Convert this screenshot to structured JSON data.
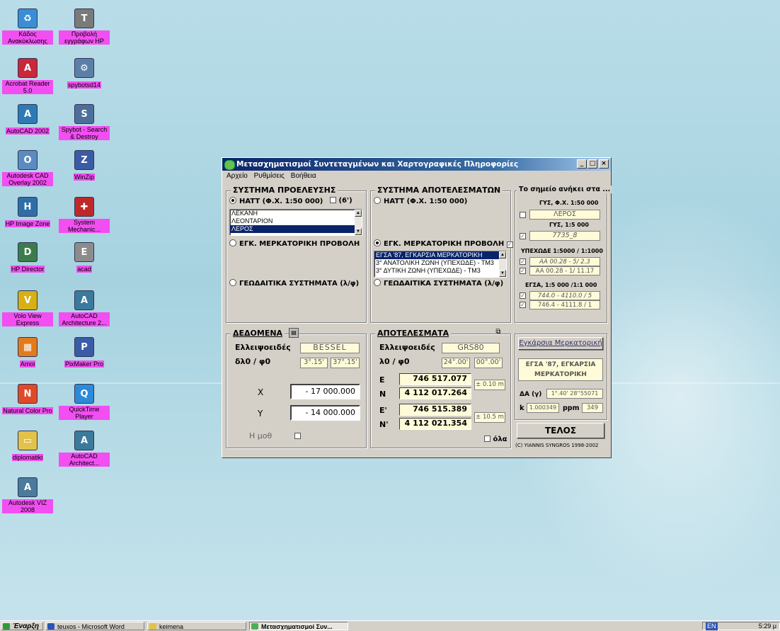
{
  "desktop": {
    "icons": [
      {
        "label": "Κάδος Ανακύκλωσης",
        "glyph": "♻",
        "color": "#3a8fd4"
      },
      {
        "label": "Προβολή εγγράφων HP",
        "glyph": "T",
        "color": "#7a7a7a"
      },
      {
        "label": "Acrobat Reader 5.0",
        "glyph": "A",
        "color": "#c8283a"
      },
      {
        "label": "spybotsd14",
        "glyph": "⚙",
        "color": "#5c7fa8"
      },
      {
        "label": "AutoCAD 2002",
        "glyph": "A",
        "color": "#2c7bb5"
      },
      {
        "label": "Spybot - Search & Destroy",
        "glyph": "S",
        "color": "#4c6f9a"
      },
      {
        "label": "Autodesk CAD Overlay 2002",
        "glyph": "O",
        "color": "#5a8cc0"
      },
      {
        "label": "WinZip",
        "glyph": "Z",
        "color": "#3c5ba6"
      },
      {
        "label": "HP Image Zone",
        "glyph": "H",
        "color": "#2f6fa8"
      },
      {
        "label": "System Mechanic...",
        "glyph": "✚",
        "color": "#c02828"
      },
      {
        "label": "HP Director",
        "glyph": "D",
        "color": "#3c7c4c"
      },
      {
        "label": "acad",
        "glyph": "E",
        "color": "#8c8c8c"
      },
      {
        "label": "Volo View Express",
        "glyph": "V",
        "color": "#d6b014"
      },
      {
        "label": "AutoCAD Architecture 2...",
        "glyph": "A",
        "color": "#3a7a9c"
      },
      {
        "label": "Amoi",
        "glyph": "▦",
        "color": "#e27a1e"
      },
      {
        "label": "PixMaker Pro",
        "glyph": "P",
        "color": "#3a5ca8"
      },
      {
        "label": "Natural Color Pro",
        "glyph": "N",
        "color": "#e04a28"
      },
      {
        "label": "QuickTime Player",
        "glyph": "Q",
        "color": "#2c8ad8"
      },
      {
        "label": "diplomatiki",
        "glyph": "▭",
        "color": "#e2c24a"
      },
      {
        "label": "AutoCAD Architect...",
        "glyph": "A",
        "color": "#3a7a9c"
      },
      {
        "label": "Autodesk VIZ 2008",
        "glyph": "A",
        "color": "#4a7a9c"
      }
    ]
  },
  "taskbar": {
    "start_label": "Έναρξη",
    "buttons": [
      {
        "label": "teuxos - Microsoft Word",
        "color": "#2a56b4"
      },
      {
        "label": "keimena",
        "color": "#e2c24a"
      },
      {
        "label": "Μετασχηματισμοί Συν...",
        "color": "#4caf50"
      }
    ],
    "tray_lang": "EN",
    "tray_time": "5:29 μ"
  },
  "window": {
    "title": "Μετασχηματισμοί Συντεταγμένων και Χαρτογραφικές Πληροφορίες",
    "buttons": {
      "minimize": "_",
      "maximize": "□",
      "close": "×"
    },
    "menu": [
      "Αρχείο",
      "Ρυθμίσεις",
      "Βοήθεια"
    ],
    "source": {
      "title": "ΣΥΣΤΗΜΑ ΠΡΟΕΛΕΥΣΗΣ",
      "opt_hatt": "HATT (Φ.Χ. 1:50 000)",
      "opt_6": "(6')",
      "hatt_list": [
        "ΛΕΚΑΝΗ",
        "ΛΕΟΝΤΑΡΙΟΝ",
        "ΛΕΡΟΣ"
      ],
      "hatt_selected": 2,
      "opt_merc": "ΕΓΚ. ΜΕΡΚΑΤΟΡΙΚΗ ΠΡΟΒΟΛΗ",
      "opt_geod": "ΓΕΩΔΑΙΤΙΚΑ ΣΥΣΤΗΜΑΤΑ (λ/φ)"
    },
    "target": {
      "title": "ΣΥΣΤΗΜΑ ΑΠΟΤΕΛΕΣΜΑΤΩΝ",
      "opt_hatt": "HATT (Φ.Χ. 1:50 000)",
      "opt_merc": "ΕΓΚ. ΜΕΡΚΑΤΟΡΙΚΗ ΠΡΟΒΟΛΗ",
      "merc_list": [
        "ΕΓΣΑ '87, ΕΓΚΑΡΣΙΑ ΜΕΡΚΑΤΟΡΙΚΗ",
        "3° ΑΝΑΤΟΛΙΚΗ ΖΩΝΗ (ΥΠΕΧΩΔΕ) - ΤΜ3",
        "3° ΔΥΤΙΚΗ ΖΩΝΗ (ΥΠΕΧΩΔΕ) - ΤΜ3"
      ],
      "merc_selected": 0,
      "opt_geod": "ΓΕΩΔΑΙΤΙΚΑ ΣΥΣΤΗΜΑΤΑ (λ/φ)"
    },
    "belongs": {
      "title": "Το σημείο ανήκει στα ...",
      "gys50_label": "ΓΥΣ, Φ.Χ. 1:50 000",
      "gys50_value": "ΛΕΡΟΣ",
      "gys5_label": "ΓΥΣ,  1:5 000",
      "gys5_value": "7735_8",
      "ypexode_label": "ΥΠΕΧΩΔΕ 1:5000 / 1:1000",
      "ypexode_v1": "AA 00.28 - 5/ 2.3",
      "ypexode_v2": "AA 00.28 - 1/ 11.17",
      "egsa_label": "ΕΓΣΑ, 1:5 000 /1:1 000",
      "egsa_v1": "744.0 - 4110.0 / 5",
      "egsa_v2": "746.4 - 4111.8 / 1"
    },
    "data": {
      "title": "ΔΕΔΟΜΕΝΑ",
      "ellipsoid_label": "Ελλειψοειδές",
      "ellipsoid_value": "BESSEL",
      "dlf_label": "δλ0 / φ0",
      "dl0": "3°.15'",
      "f0": "37°.15'",
      "x_label": "X",
      "x_value": "- 17 000.000",
      "y_label": "Y",
      "y_value": "- 14 000.000",
      "hmth_label": "H μοθ"
    },
    "results": {
      "title": "ΑΠΟΤΕΛΕΣΜΑΤΑ",
      "ellipsoid_label": "Ελλειψοειδές",
      "ellipsoid_value": "GRS80",
      "lf_label": "λ0 / φ0",
      "l0": "24°.00'",
      "f0": "00°.00'",
      "e_label": "E",
      "e_value": "746 517.077",
      "n_label": "N",
      "n_value": "4 112 017.264",
      "acc1": "± 0.10 m",
      "e2_label": "E'",
      "e2_value": "746 515.389",
      "n2_label": "N'",
      "n2_value": "4 112 021.354",
      "acc2": "± 10.5 m",
      "all_label": "όλα"
    },
    "proj": {
      "button": "Εγκάρσια Μερκατορική",
      "name": "ΕΓΣΑ '87, ΕΓΚΑΡΣΙΑ ΜΕΡΚΑΤΟΡΙΚΗ",
      "da_label": "ΔΑ (γ)",
      "da_value": "1°.40' 28''55071",
      "k_label": "k",
      "k_value": "1.000349",
      "ppm_label": "ppm",
      "ppm_value": "349"
    },
    "end_button": "ΤΕΛΟΣ",
    "copyright": "(C) YIANNIS SYNGROS 1998-2002"
  }
}
